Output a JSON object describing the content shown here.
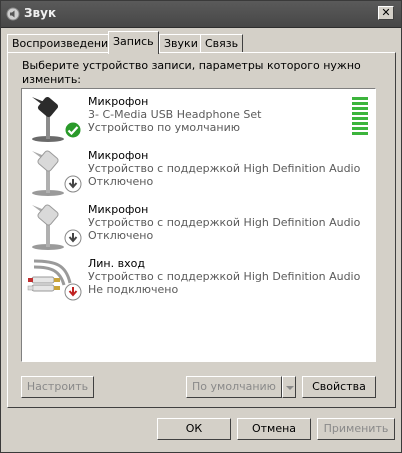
{
  "window": {
    "title": "Звук",
    "close_label": "✕"
  },
  "tabs": [
    {
      "label": "Воспроизведение",
      "active": false
    },
    {
      "label": "Запись",
      "active": true
    },
    {
      "label": "Звуки",
      "active": false
    },
    {
      "label": "Связь",
      "active": false
    }
  ],
  "instruction": "Выберите устройство записи, параметры которого нужно изменить:",
  "devices": [
    {
      "name": "Микрофон",
      "detail": "3- C-Media USB Headphone Set",
      "status": "Устройство по умолчанию",
      "icon": "microphone-icon",
      "badge": "default-checkmark-icon",
      "level_meter": true,
      "level_fraction": 1.0
    },
    {
      "name": "Микрофон",
      "detail": "Устройство с поддержкой High Definition Audio",
      "status": "Отключено",
      "icon": "microphone-icon",
      "badge": "disabled-arrow-icon"
    },
    {
      "name": "Микрофон",
      "detail": "Устройство с поддержкой High Definition Audio",
      "status": "Отключено",
      "icon": "microphone-icon",
      "badge": "disabled-arrow-icon"
    },
    {
      "name": "Лин. вход",
      "detail": "Устройство с поддержкой High Definition Audio",
      "status": "Не подключено",
      "icon": "line-in-cable-icon",
      "badge": "not-connected-icon"
    }
  ],
  "buttons": {
    "configure": "Настроить",
    "default": "По умолчанию",
    "properties": "Свойства",
    "ok": "ОК",
    "cancel": "Отмена",
    "apply": "Применить"
  },
  "colors": {
    "title_bar": "#4f4f4f",
    "face": "#d4d0c8",
    "level_green": "#3cb43c",
    "default_badge": "#2a9a2a",
    "not_connected_badge": "#c02020"
  }
}
